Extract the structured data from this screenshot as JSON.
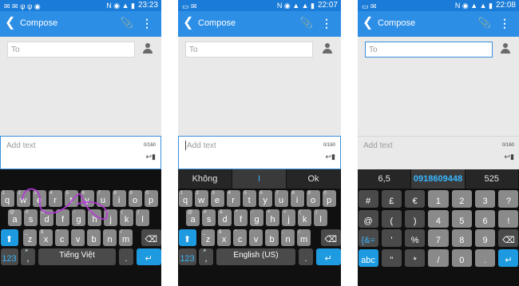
{
  "screens": [
    {
      "status": {
        "left_icons": "✉ ✉ ψ ψ ◉",
        "right_icons": "N ◉ ▲ ▮",
        "time": "23:23"
      },
      "appbar": {
        "back": "❮",
        "title": "Compose",
        "clip": "📎",
        "more": "⋮"
      },
      "to_placeholder": "To",
      "compose": {
        "placeholder": "Add text",
        "counter": "0/160",
        "send": "↩▮"
      }
    },
    {
      "status": {
        "left_icons": "▭ ✉",
        "right_icons": "N ◉ ▲ ▲ ▮",
        "time": "22:07"
      },
      "appbar": {
        "back": "❮",
        "title": "Compose",
        "clip": "📎",
        "more": "⋮"
      },
      "to_placeholder": "To",
      "compose": {
        "placeholder": "Add text",
        "counter": "0/160",
        "send": "↩▮"
      },
      "suggestions": [
        "Không",
        "I",
        "Ok"
      ]
    },
    {
      "status": {
        "left_icons": "▭ ✉",
        "right_icons": "N ◉ ▲ ▲ ▮",
        "time": "22:08"
      },
      "appbar": {
        "back": "❮",
        "title": "Compose",
        "clip": "📎",
        "more": "⋮"
      },
      "to_placeholder": "To",
      "compose": {
        "placeholder": "Add text",
        "counter": "0/160",
        "send": "↩▮"
      },
      "suggestions": [
        "6,5",
        "0918609448",
        "525"
      ]
    }
  ],
  "alpha_keyboard": {
    "row1": [
      {
        "k": "q",
        "s": "1"
      },
      {
        "k": "w",
        "s": "2"
      },
      {
        "k": "e",
        "s": "3"
      },
      {
        "k": "r",
        "s": "4"
      },
      {
        "k": "t",
        "s": "5"
      },
      {
        "k": "y",
        "s": "6"
      },
      {
        "k": "u",
        "s": "7"
      },
      {
        "k": "i",
        "s": "8"
      },
      {
        "k": "o",
        "s": "9"
      },
      {
        "k": "p",
        "s": "0"
      }
    ],
    "row2": [
      {
        "k": "a",
        "s": "@"
      },
      {
        "k": "s",
        "s": "#"
      },
      {
        "k": "d",
        "s": "&"
      },
      {
        "k": "f",
        "s": "*"
      },
      {
        "k": "g",
        "s": "-"
      },
      {
        "k": "h",
        "s": "+"
      },
      {
        "k": "j",
        "s": "="
      },
      {
        "k": "k",
        "s": "("
      },
      {
        "k": "l",
        "s": ")"
      }
    ],
    "row3": [
      {
        "k": "z",
        "s": "_"
      },
      {
        "k": "x",
        "s": "$"
      },
      {
        "k": "c",
        "s": "\""
      },
      {
        "k": "v",
        "s": "'"
      },
      {
        "k": "b",
        "s": ":"
      },
      {
        "k": "n",
        "s": ";"
      },
      {
        "k": "m",
        "s": "/"
      }
    ],
    "shift": "⬆",
    "backspace": "⌫",
    "sym": "123",
    "comma": ",",
    "mic": "🎤",
    "period": ".",
    "enter": "↵",
    "space_labels": [
      "Tiếng Việt",
      "English (US)"
    ]
  },
  "num_keyboard": {
    "row1": [
      "#",
      "£",
      "€",
      "1",
      "2",
      "3",
      "?"
    ],
    "row2": [
      "@",
      "(",
      ")",
      "4",
      "5",
      "6",
      "!"
    ],
    "row3": [
      "{&=",
      "'",
      "%",
      "7",
      "8",
      "9",
      "⌫"
    ],
    "row4": [
      "abc",
      "\"",
      "*",
      "/",
      "0",
      ".",
      "↵"
    ]
  }
}
